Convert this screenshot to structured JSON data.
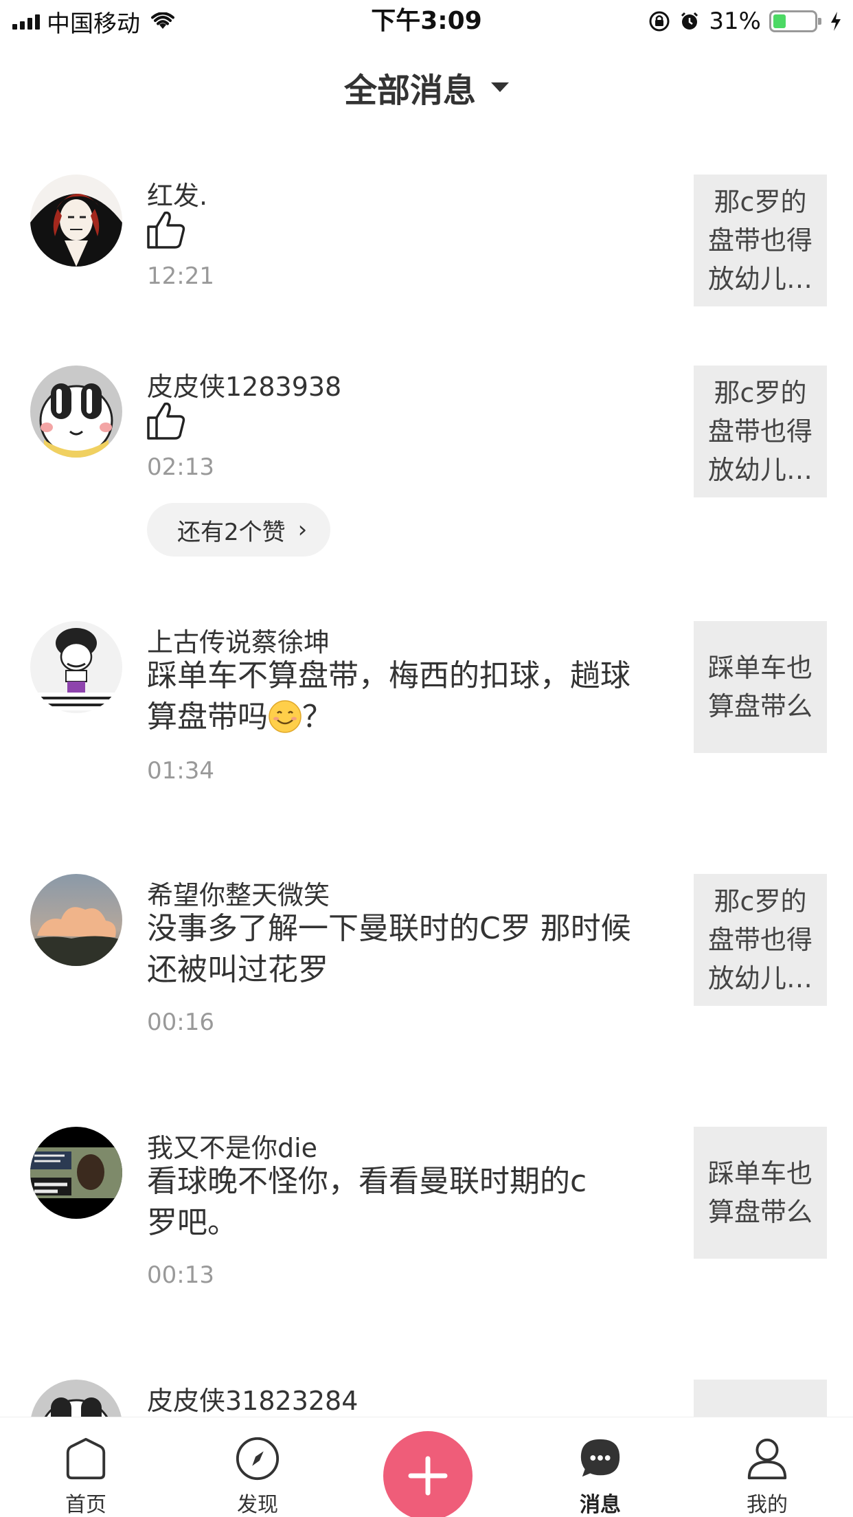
{
  "status_bar": {
    "carrier": "中国移动",
    "time": "下午3:09",
    "battery_percent": "31%",
    "battery_level": 0.31
  },
  "header": {
    "title": "全部消息",
    "dropdown_icon": "caret-down-icon"
  },
  "notifications": [
    {
      "type": "like",
      "name": "红发.",
      "time": "12:21",
      "preview": "那c罗的盘带也得放幼儿…",
      "icon": "thumbs-up-icon"
    },
    {
      "type": "like",
      "name": "皮皮侠1283938",
      "time": "02:13",
      "preview": "那c罗的盘带也得放幼儿…",
      "icon": "thumbs-up-icon",
      "more_likes": "还有2个赞"
    },
    {
      "type": "comment",
      "name": "上古传说蔡徐坤",
      "comment": "踩单车不算盘带，梅西的扣球，趟球算盘带吗",
      "comment_suffix": "？",
      "emoji": "smile-emoji-icon",
      "time": "01:34",
      "preview": "踩单车也算盘带么"
    },
    {
      "type": "comment",
      "name": "希望你整天微笑",
      "comment": "没事多了解一下曼联时的C罗 那时候还被叫过花罗",
      "time": "00:16",
      "preview": "那c罗的盘带也得放幼儿…"
    },
    {
      "type": "comment",
      "name": "我又不是你die",
      "comment": "看球晚不怪你，看看曼联时期的c罗吧。",
      "time": "00:13",
      "preview": "踩单车也算盘带么"
    },
    {
      "type": "partial",
      "name": "皮皮侠31823284"
    }
  ],
  "tabbar": {
    "tabs": [
      {
        "label": "首页",
        "icon": "home-icon"
      },
      {
        "label": "发现",
        "icon": "compass-icon"
      },
      {
        "label": "消息",
        "icon": "chat-bubble-icon",
        "active": true
      },
      {
        "label": "我的",
        "icon": "profile-icon"
      }
    ],
    "plus_icon": "plus-icon",
    "accent": "#ef5d79"
  }
}
